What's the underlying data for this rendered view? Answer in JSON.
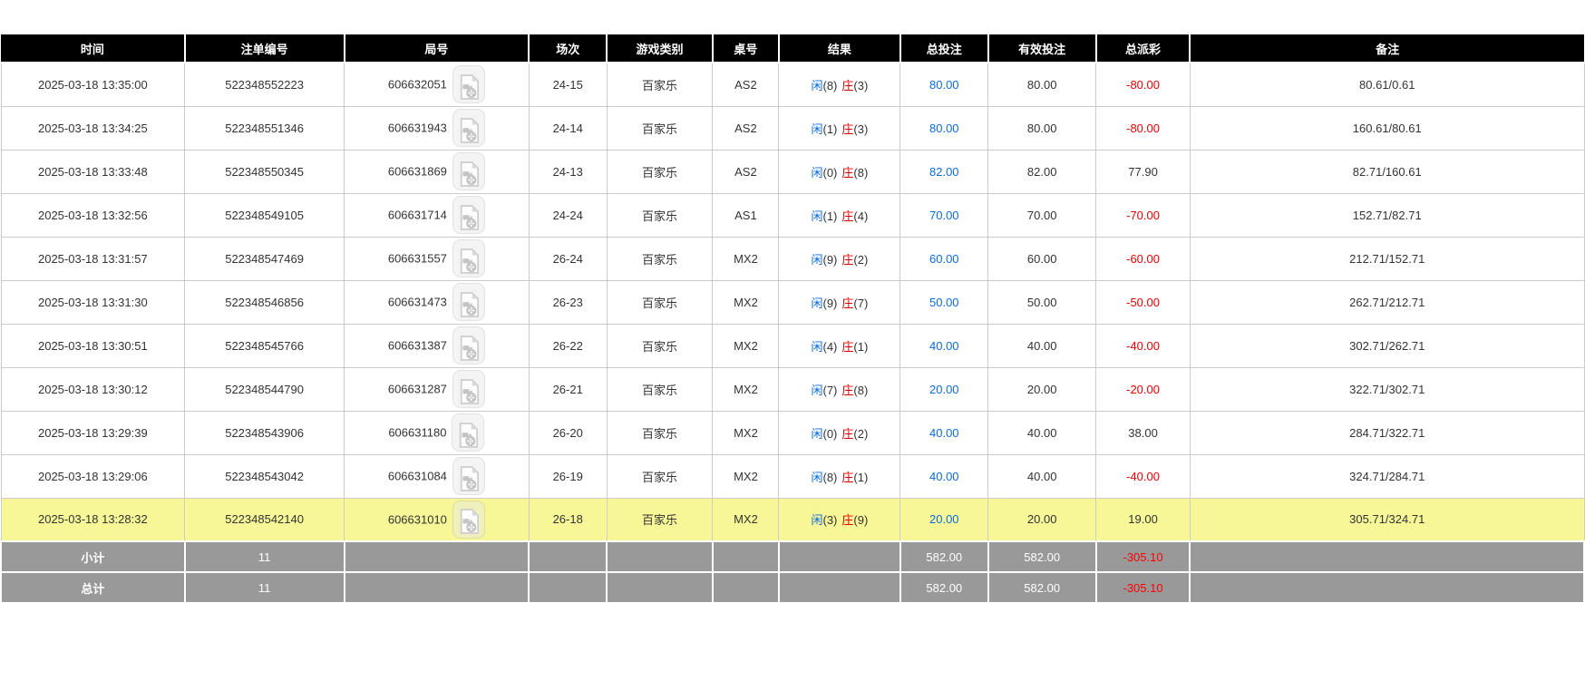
{
  "colors": {
    "header_bg": "#000000",
    "accent_blue": "#0c6ce0",
    "negative_red": "#e60000",
    "highlight_yellow": "#f7f798",
    "summary_bg": "#999999"
  },
  "icons": {
    "video_replay": "video-file-icon"
  },
  "table": {
    "columns": [
      "时间",
      "注单编号",
      "局号",
      "场次",
      "游戏类别",
      "桌号",
      "结果",
      "总投注",
      "有效投注",
      "总派彩",
      "备注"
    ],
    "rows": [
      {
        "time": "2025-03-18 13:35:00",
        "bet_id": "522348552223",
        "round_id": "606632051",
        "session": "24-15",
        "game_type": "百家乐",
        "table_id": "AS2",
        "result": {
          "player_label": "闲",
          "player_score": "(8)",
          "banker_label": "庄",
          "banker_score": "(3)"
        },
        "total_bet": "80.00",
        "valid_bet": "80.00",
        "payout": "-80.00",
        "remark": "80.61/0.61",
        "highlighted": false
      },
      {
        "time": "2025-03-18 13:34:25",
        "bet_id": "522348551346",
        "round_id": "606631943",
        "session": "24-14",
        "game_type": "百家乐",
        "table_id": "AS2",
        "result": {
          "player_label": "闲",
          "player_score": "(1)",
          "banker_label": "庄",
          "banker_score": "(3)"
        },
        "total_bet": "80.00",
        "valid_bet": "80.00",
        "payout": "-80.00",
        "remark": "160.61/80.61",
        "highlighted": false
      },
      {
        "time": "2025-03-18 13:33:48",
        "bet_id": "522348550345",
        "round_id": "606631869",
        "session": "24-13",
        "game_type": "百家乐",
        "table_id": "AS2",
        "result": {
          "player_label": "闲",
          "player_score": "(0)",
          "banker_label": "庄",
          "banker_score": "(8)"
        },
        "total_bet": "82.00",
        "valid_bet": "82.00",
        "payout": "77.90",
        "remark": "82.71/160.61",
        "highlighted": false
      },
      {
        "time": "2025-03-18 13:32:56",
        "bet_id": "522348549105",
        "round_id": "606631714",
        "session": "24-24",
        "game_type": "百家乐",
        "table_id": "AS1",
        "result": {
          "player_label": "闲",
          "player_score": "(1)",
          "banker_label": "庄",
          "banker_score": "(4)"
        },
        "total_bet": "70.00",
        "valid_bet": "70.00",
        "payout": "-70.00",
        "remark": "152.71/82.71",
        "highlighted": false
      },
      {
        "time": "2025-03-18 13:31:57",
        "bet_id": "522348547469",
        "round_id": "606631557",
        "session": "26-24",
        "game_type": "百家乐",
        "table_id": "MX2",
        "result": {
          "player_label": "闲",
          "player_score": "(9)",
          "banker_label": "庄",
          "banker_score": "(2)"
        },
        "total_bet": "60.00",
        "valid_bet": "60.00",
        "payout": "-60.00",
        "remark": "212.71/152.71",
        "highlighted": false
      },
      {
        "time": "2025-03-18 13:31:30",
        "bet_id": "522348546856",
        "round_id": "606631473",
        "session": "26-23",
        "game_type": "百家乐",
        "table_id": "MX2",
        "result": {
          "player_label": "闲",
          "player_score": "(9)",
          "banker_label": "庄",
          "banker_score": "(7)"
        },
        "total_bet": "50.00",
        "valid_bet": "50.00",
        "payout": "-50.00",
        "remark": "262.71/212.71",
        "highlighted": false
      },
      {
        "time": "2025-03-18 13:30:51",
        "bet_id": "522348545766",
        "round_id": "606631387",
        "session": "26-22",
        "game_type": "百家乐",
        "table_id": "MX2",
        "result": {
          "player_label": "闲",
          "player_score": "(4)",
          "banker_label": "庄",
          "banker_score": "(1)"
        },
        "total_bet": "40.00",
        "valid_bet": "40.00",
        "payout": "-40.00",
        "remark": "302.71/262.71",
        "highlighted": false
      },
      {
        "time": "2025-03-18 13:30:12",
        "bet_id": "522348544790",
        "round_id": "606631287",
        "session": "26-21",
        "game_type": "百家乐",
        "table_id": "MX2",
        "result": {
          "player_label": "闲",
          "player_score": "(7)",
          "banker_label": "庄",
          "banker_score": "(8)"
        },
        "total_bet": "20.00",
        "valid_bet": "20.00",
        "payout": "-20.00",
        "remark": "322.71/302.71",
        "highlighted": false
      },
      {
        "time": "2025-03-18 13:29:39",
        "bet_id": "522348543906",
        "round_id": "606631180",
        "session": "26-20",
        "game_type": "百家乐",
        "table_id": "MX2",
        "result": {
          "player_label": "闲",
          "player_score": "(0)",
          "banker_label": "庄",
          "banker_score": "(2)"
        },
        "total_bet": "40.00",
        "valid_bet": "40.00",
        "payout": "38.00",
        "remark": "284.71/322.71",
        "highlighted": false
      },
      {
        "time": "2025-03-18 13:29:06",
        "bet_id": "522348543042",
        "round_id": "606631084",
        "session": "26-19",
        "game_type": "百家乐",
        "table_id": "MX2",
        "result": {
          "player_label": "闲",
          "player_score": "(8)",
          "banker_label": "庄",
          "banker_score": "(1)"
        },
        "total_bet": "40.00",
        "valid_bet": "40.00",
        "payout": "-40.00",
        "remark": "324.71/284.71",
        "highlighted": false
      },
      {
        "time": "2025-03-18 13:28:32",
        "bet_id": "522348542140",
        "round_id": "606631010",
        "session": "26-18",
        "game_type": "百家乐",
        "table_id": "MX2",
        "result": {
          "player_label": "闲",
          "player_score": "(3)",
          "banker_label": "庄",
          "banker_score": "(9)"
        },
        "total_bet": "20.00",
        "valid_bet": "20.00",
        "payout": "19.00",
        "remark": "305.71/324.71",
        "highlighted": true
      }
    ],
    "summary_rows": [
      {
        "label": "小计",
        "count": "11",
        "total_bet": "582.00",
        "valid_bet": "582.00",
        "payout": "-305.10"
      },
      {
        "label": "总计",
        "count": "11",
        "total_bet": "582.00",
        "valid_bet": "582.00",
        "payout": "-305.10"
      }
    ]
  }
}
